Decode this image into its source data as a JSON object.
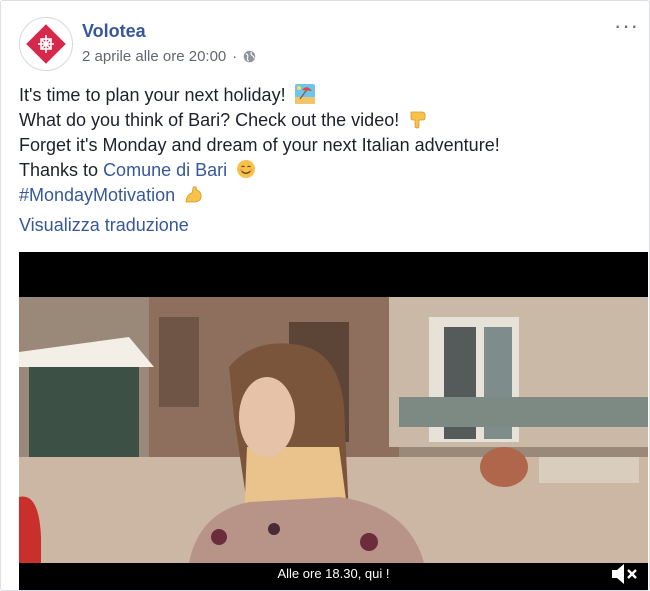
{
  "post": {
    "page_name": "Volotea",
    "timestamp": "2 aprile alle ore 20:00",
    "dot": "·",
    "more_label": "···",
    "text_lines": {
      "l1": "It's time to plan your next holiday!",
      "l2": "What do you think of Bari? Check out the video!",
      "l3": "Forget it's Monday and dream of your next Italian adventure!",
      "l4_prefix": "Thanks to",
      "l4_link": "Comune di Bari",
      "l5_hashtag": "#MondayMotivation"
    },
    "translate_label": "Visualizza traduzione"
  },
  "video": {
    "caption": "Alle ore 18.30, qui !"
  },
  "icons": [
    "logo-icon",
    "globe-icon",
    "beach-emoji-icon",
    "point-down-emoji-icon",
    "smile-emoji-icon",
    "flex-emoji-icon",
    "mute-icon"
  ],
  "colors": {
    "link": "#365899",
    "meta": "#616770",
    "text": "#1d2129"
  }
}
